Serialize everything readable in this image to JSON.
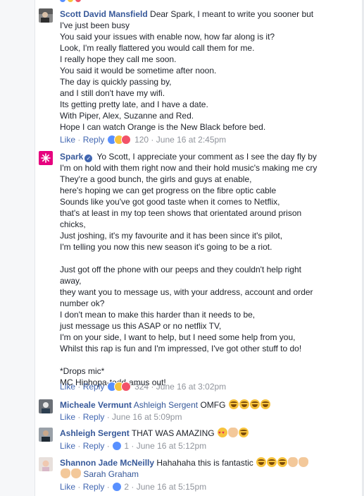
{
  "comments": [
    {
      "author": "Scott David Mansfield",
      "lines": [
        "Dear Spark, I meant to write you sooner but",
        "I've just been busy",
        "You said your issues with enable now, how far along is it?",
        "Look, I'm really flattered you would call them for me.",
        "I really hope they call me soon.",
        "You said it would be sometime after noon.",
        "The day is quickly passing by,",
        "and I still don't have my wifi.",
        "Its getting pretty late, and I have a date.",
        "With Piper, Alex, Suzanne and Red.",
        "Hope I can watch Orange is the New Black before bed."
      ],
      "like_label": "Like",
      "reply_label": "Reply",
      "reaction_count": "120",
      "timestamp": "June 16 at 2:45pm"
    },
    {
      "author": "Spark",
      "verified_mark": "✓",
      "lines_first": [
        "Yo Scott, I appreciate your comment as I see the day fly by",
        "I'm on hold with them right now and their hold music's making me cry",
        "They're a good bunch, the girls and guys at enable,",
        "here's hoping we can get progress on the fibre optic cable",
        "Sounds like you've got good taste when it comes to Netflix,",
        "that's at least in my top teen shows that orientated around prison",
        "chicks,",
        "Just joshing, it's my favourite and it has been since it's pilot,",
        "I'm telling you now this new season it's going to be a riot."
      ],
      "lines_second": [
        "Just got off the phone with our peeps and they couldn't help right",
        "away,",
        "they want you to message us, with your address, account and order",
        "number ok?",
        "I don't mean to make this harder than it needs to be,",
        "just message us this ASAP or no netflix TV,",
        "I'm on your side, I want to help, but I need some help from you,",
        "Whilst this rap is fun and I'm impressed, I've got other stuff to do!"
      ],
      "lines_third": [
        "*Drops mic*",
        "MC Hiphopa-todd-amus out!"
      ],
      "like_label": "Like",
      "reply_label": "Reply",
      "reaction_count": "324",
      "timestamp": "June 16 at 3:02pm"
    },
    {
      "author": "Micheale Vermunt",
      "tagged": "Ashleigh Sergent",
      "text": "OMFG",
      "emojis": [
        "face-with-tears-of-joy",
        "face-with-tears-of-joy",
        "face-with-tears-of-joy",
        "face-with-tears-of-joy"
      ],
      "like_label": "Like",
      "reply_label": "Reply",
      "timestamp": "June 16 at 5:09pm"
    },
    {
      "author": "Ashleigh Sergent",
      "text": "THAT WAS AMAZING",
      "emojis": [
        "heart-eyes-face",
        "raising-hands",
        "face-with-tears-of-joy"
      ],
      "like_label": "Like",
      "reply_label": "Reply",
      "like_count": "1",
      "timestamp": "June 16 at 5:12pm"
    },
    {
      "author": "Shannon Jade McNeilly",
      "text": "Hahahaha this is fantastic",
      "emojis": [
        "face-with-tears-of-joy",
        "face-with-tears-of-joy",
        "face-with-tears-of-joy",
        "clapping-hands",
        "clapping-hands",
        "clapping-hands",
        "clapping-hands"
      ],
      "tagged": "Sarah Graham",
      "like_label": "Like",
      "reply_label": "Reply",
      "like_count": "2",
      "timestamp": "June 16 at 5:15pm"
    }
  ],
  "separator": " · ",
  "colors": {
    "link": "#365899",
    "action": "#4267b2",
    "meta": "#90949c",
    "like": "#5890ff",
    "haha": "#f7c33d",
    "love": "#f25268",
    "spark_brand": "#e6007e"
  }
}
